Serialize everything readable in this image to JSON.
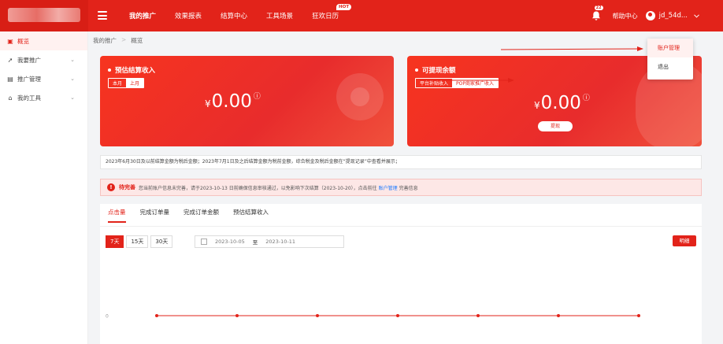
{
  "header": {
    "nav": [
      {
        "label": "我的推广",
        "active": true
      },
      {
        "label": "效果报表"
      },
      {
        "label": "结算中心"
      },
      {
        "label": "工具场景"
      },
      {
        "label": "狂欢日历",
        "badge": "HOT"
      }
    ],
    "bell_count": "22",
    "help": "帮助中心",
    "user": "jd_54d..."
  },
  "user_menu": [
    {
      "label": "账户管理",
      "active": true
    },
    {
      "label": "退出"
    }
  ],
  "sidebar": {
    "items": [
      {
        "label": "概览",
        "icon": "overview-icon",
        "active": true
      },
      {
        "label": "我要推广",
        "icon": "promote-icon"
      },
      {
        "label": "推广管理",
        "icon": "manage-icon"
      },
      {
        "label": "我的工具",
        "icon": "tools-icon"
      }
    ]
  },
  "breadcrumb": {
    "root": "我的推广",
    "current": "概览"
  },
  "card_estimate": {
    "title": "预估结算收入",
    "tabs": [
      "本月",
      "上月"
    ],
    "currency": "¥",
    "amount": "0.00"
  },
  "card_balance": {
    "title": "可提现余额",
    "tabs": [
      "平台补贴收入",
      "POP商家推广收入"
    ],
    "currency": "¥",
    "amount": "0.00",
    "withdraw": "提现"
  },
  "notice": "2023年6月30日及以前结算金额为税后金额；2023年7月1日及之后结算金额为税前金额，综合税金及税后金额在“提现记录”中查看并展示；",
  "alert": {
    "title": "待完善",
    "text_before": "您当前账户信息未完善，请于2023-10-13 日前确保信息审核通过，以免影响下次结算（2023-10-20），点击前往",
    "link": "账户管理",
    "text_after": "完善信息"
  },
  "chart_panel": {
    "tabs": [
      "点击量",
      "完成订单量",
      "完成订单金额",
      "预估结算收入"
    ],
    "ranges": [
      "7天",
      "15天",
      "30天"
    ],
    "date_start": "2023-10-05",
    "date_sep": "至",
    "date_end": "2023-10-11",
    "detail": "明细"
  },
  "chart_data": {
    "type": "line",
    "y_tick": "0",
    "values": [
      0,
      0,
      0,
      0,
      0,
      0,
      0
    ],
    "color": "#e2231a"
  }
}
